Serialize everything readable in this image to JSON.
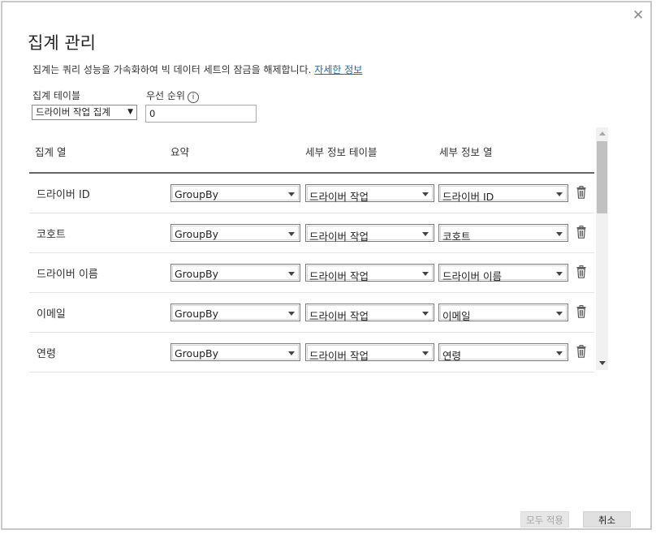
{
  "dialog": {
    "title": "집계 관리",
    "description": "집계는 쿼리 성능을 가속화하여 빅 데이터 세트의 잠금을 해제합니다.",
    "learn_more": "자세한 정보",
    "close_glyph": "✕"
  },
  "aggregation_table": {
    "label": "집계 테이블",
    "value": "드라이버 작업 집계",
    "caret": "▼"
  },
  "priority": {
    "label": "우선 순위",
    "info_glyph": "i",
    "value": "0"
  },
  "columns": {
    "agg_column": "집계 열",
    "summarization": "요약",
    "detail_table": "세부 정보 테이블",
    "detail_column": "세부 정보 열"
  },
  "rows": [
    {
      "label": "드라이버 ID",
      "summarization": "GroupBy",
      "detail_table": "드라이버 작업",
      "detail_column": "드라이버 ID"
    },
    {
      "label": "코호트",
      "summarization": "GroupBy",
      "detail_table": "드라이버 작업",
      "detail_column": "코호트"
    },
    {
      "label": "드라이버 이름",
      "summarization": "GroupBy",
      "detail_table": "드라이버 작업",
      "detail_column": "드라이버 이름"
    },
    {
      "label": "이메일",
      "summarization": "GroupBy",
      "detail_table": "드라이버 작업",
      "detail_column": "이메일"
    },
    {
      "label": "연령",
      "summarization": "GroupBy",
      "detail_table": "드라이버 작업",
      "detail_column": "연령"
    }
  ],
  "buttons": {
    "apply_all": "모두 적용",
    "cancel": "취소"
  },
  "colors": {
    "link": "#2467a8",
    "disabled_text": "#a6a6a6"
  }
}
